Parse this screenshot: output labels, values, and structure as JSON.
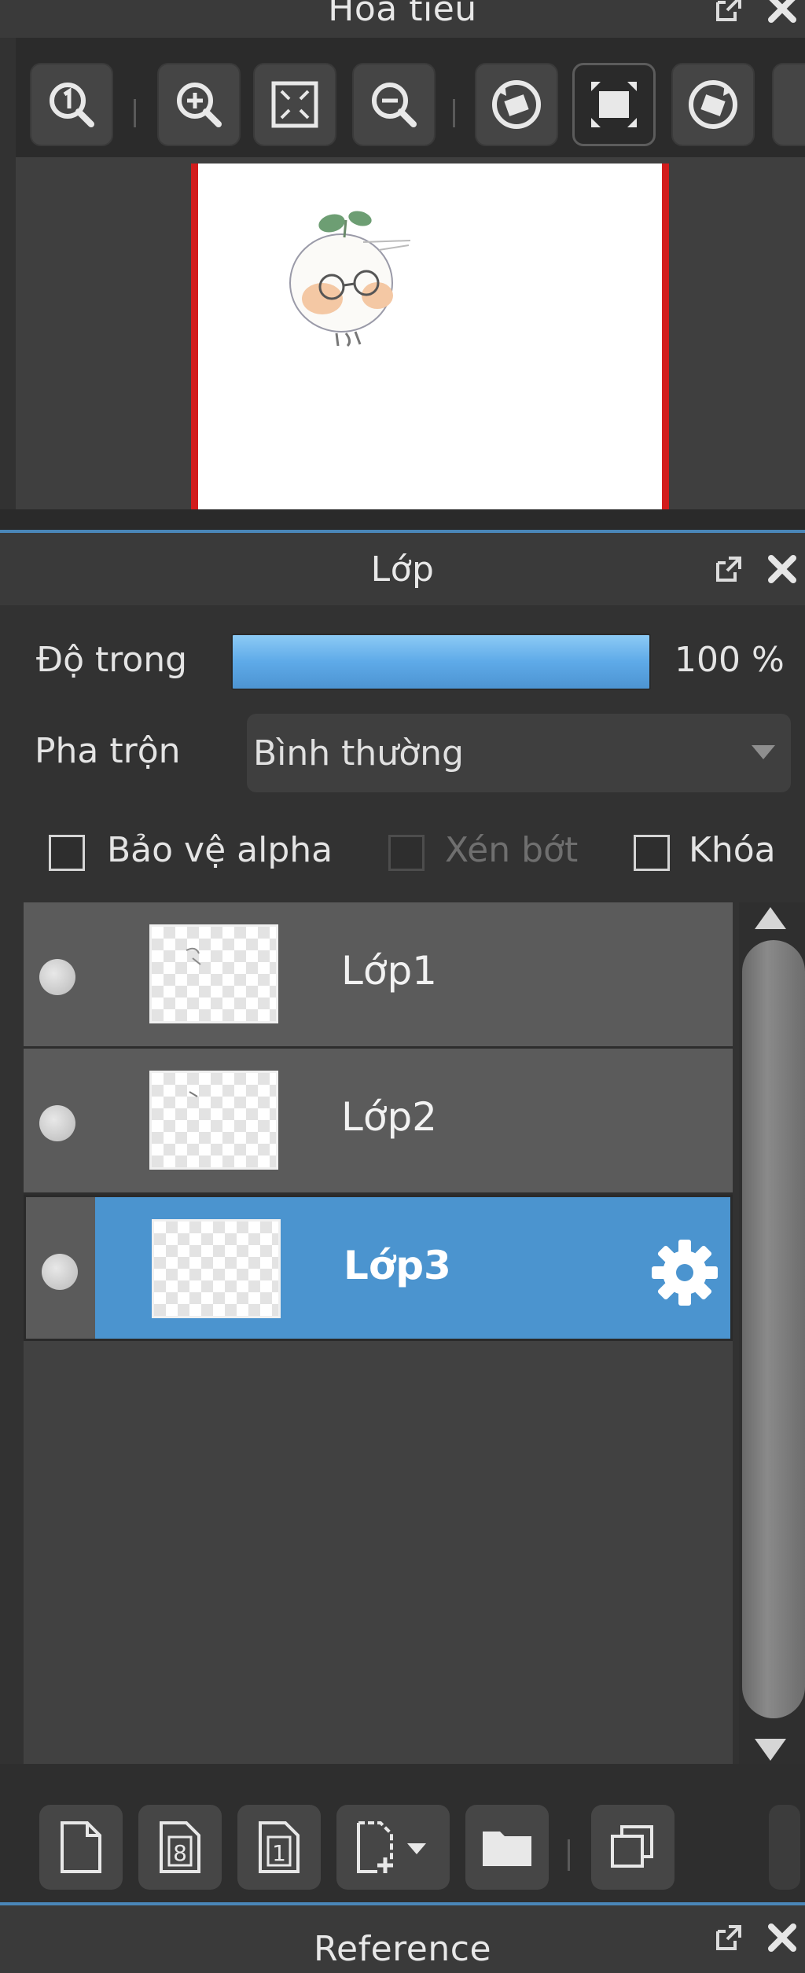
{
  "navigator": {
    "title": "Hoa tiêu",
    "toolbar_buttons": [
      "actual-size",
      "zoom-in",
      "fit-window",
      "zoom-out",
      "rotate-left",
      "fit-canvas",
      "rotate-right"
    ]
  },
  "layer_panel": {
    "title": "Lớp",
    "opacity_label": "Độ trong",
    "opacity_value": "100 %",
    "opacity_fraction": 1.0,
    "blend_label": "Pha trộn",
    "blend_value": "Bình thường",
    "checkboxes": {
      "protect_alpha": "Bảo vệ alpha",
      "clipping": "Xén bớt",
      "lock": "Khóa"
    },
    "layers": [
      {
        "name": "Lớp1",
        "selected": false
      },
      {
        "name": "Lớp2",
        "selected": false
      },
      {
        "name": "Lớp3",
        "selected": true
      }
    ]
  },
  "reference": {
    "title": "Reference"
  },
  "colors": {
    "accent": "#4b94cf",
    "canvas_border": "#d21d1d"
  }
}
